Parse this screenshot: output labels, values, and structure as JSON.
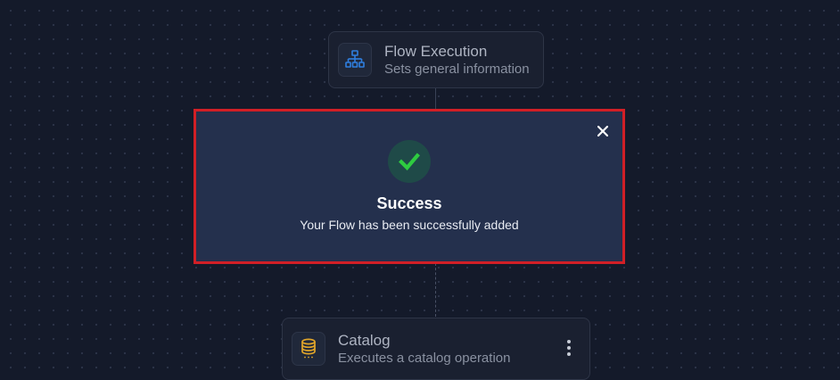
{
  "flow_node": {
    "title": "Flow Execution",
    "subtitle": "Sets general information",
    "icon": "hierarchy-icon",
    "icon_color": "#2f7fe0"
  },
  "catalog_node": {
    "title": "Catalog",
    "subtitle": "Executes a catalog operation",
    "icon": "database-icon",
    "icon_color": "#e0a52a",
    "menu_icon": "kebab-menu-icon"
  },
  "success_modal": {
    "title": "Success",
    "message": "Your Flow has been successfully added",
    "icon": "check-icon",
    "check_color": "#2ecc40",
    "close_icon": "close-icon",
    "highlight_color": "#d11f26"
  }
}
